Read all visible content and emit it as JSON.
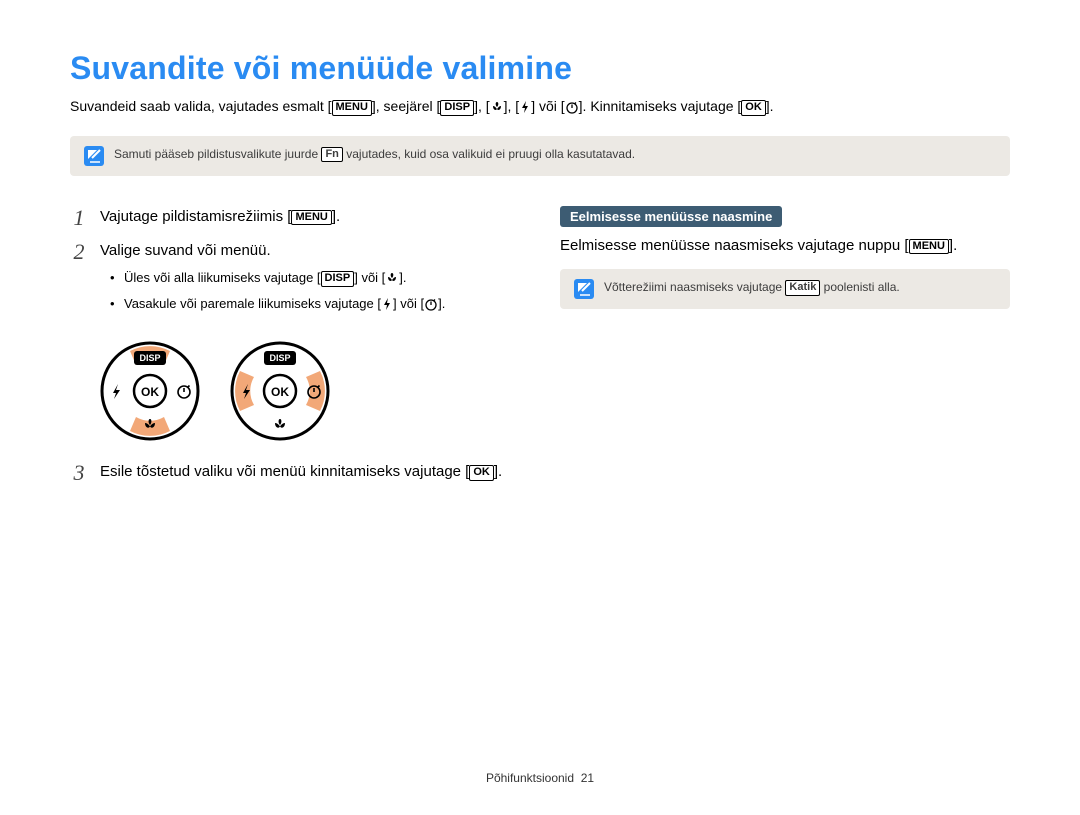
{
  "title": "Suvandite või menüüde valimine",
  "intro": {
    "p1": "Suvandeid saab valida, vajutades esmalt [",
    "menu_label": "MENU",
    "p2": "], seejärel [",
    "disp_label": "DISP",
    "p3": "], [",
    "p4": "], [",
    "p5": "] või [",
    "p6": "]. Kinnitamiseks vajutage [",
    "ok_label": "OK",
    "p7": "]."
  },
  "note1": {
    "t1": "Samuti pääseb pildistusvalikute juurde ",
    "fn_label": "Fn",
    "t2": " vajutades, kuid osa valikuid ei pruugi olla kasutatavad."
  },
  "steps": {
    "n1": "1",
    "s1a": "Vajutage pildistamisrežiimis [",
    "s1b": "].",
    "n2": "2",
    "s2": "Valige suvand või menüü.",
    "s2a1": "Üles või alla liikumiseks vajutage [",
    "s2a2": "] või [",
    "s2a3": "].",
    "s2b1": "Vasakule või paremale liikumiseks vajutage [",
    "s2b2": "] või [",
    "s2b3": "].",
    "n3": "3",
    "s3a": "Esile tõstetud valiku või menüü kinnitamiseks vajutage [",
    "s3b": "]."
  },
  "right": {
    "subhead": "Eelmisesse menüüsse naasmine",
    "t1": "Eelmisesse menüüsse naasmiseks vajutage nuppu [",
    "t2": "].",
    "note_a": "Võtterežiimi naasmiseks vajutage ",
    "note_key": "Katik",
    "note_b": " poolenisti alla."
  },
  "dial": {
    "disp": "DISP",
    "ok": "OK"
  },
  "footer": {
    "section": "Põhifunktsioonid",
    "page": "21"
  },
  "icons": {
    "macro": "macro-icon",
    "flash": "flash-icon",
    "timer": "timer-icon"
  }
}
